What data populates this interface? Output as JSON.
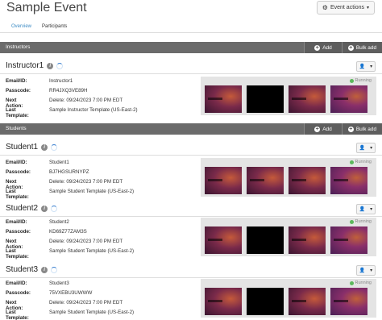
{
  "page": {
    "title": "Sample Event",
    "event_actions_label": "Event actions"
  },
  "tabs": [
    {
      "label": "Overview"
    },
    {
      "label": "Participants"
    }
  ],
  "instructors_section": {
    "label": "Instructors",
    "add_label": "Add",
    "bulk_add_label": "Bulk add"
  },
  "students_section": {
    "label": "Students",
    "add_label": "Add",
    "bulk_add_label": "Bulk add"
  },
  "field_labels": {
    "email": "Email/ID:",
    "passcode": "Passcode:",
    "next_action": "Next Action:",
    "last_template": "Last Template:"
  },
  "participants": [
    {
      "name": "Instructor1",
      "email": "Instructor1",
      "passcode": "RR4JXQ3VE89H",
      "next_action": "Delete: 09/24/2023 7:00 PM EDT",
      "last_template": "Sample Instructor Template (US-East-2)",
      "status": "Running"
    },
    {
      "name": "Student1",
      "email": "Student1",
      "passcode": "BJ7HGSURNYPZ",
      "next_action": "Delete: 09/24/2023 7:00 PM EDT",
      "last_template": "Sample Student Template (US-East-2)",
      "status": "Running"
    },
    {
      "name": "Student2",
      "email": "Student2",
      "passcode": "KD69Z77ZAM3S",
      "next_action": "Delete: 09/24/2023 7:00 PM EDT",
      "last_template": "Sample Student Template (US-East-2)",
      "status": "Running"
    },
    {
      "name": "Student3",
      "email": "Student3",
      "passcode": "75VXEBU3UWWW",
      "next_action": "Delete: 09/24/2023 7:00 PM EDT",
      "last_template": "Sample Student Template (US-East-2)",
      "status": "Running"
    }
  ],
  "colors": {
    "section_bar": "#6b6b6b",
    "link": "#3a8ac4",
    "running": "#5cb85c"
  }
}
